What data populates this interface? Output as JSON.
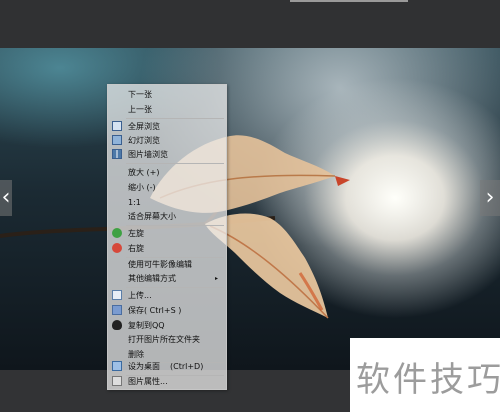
{
  "navigation": {
    "prev_arrow": "‹",
    "next_arrow": "›"
  },
  "context_menu": {
    "items": [
      {
        "label": "下一张"
      },
      {
        "label": "上一张"
      },
      {
        "label": "全屏浏览",
        "icon": "fullscreen-icon"
      },
      {
        "label": "幻灯浏览",
        "icon": "slideshow-icon"
      },
      {
        "label": "图片墙浏览",
        "icon": "picture-wall-icon"
      },
      {
        "label": "放大 (+)"
      },
      {
        "label": "缩小 (-)"
      },
      {
        "label": "1:1"
      },
      {
        "label": "适合屏幕大小"
      },
      {
        "label": "左旋",
        "icon": "rotate-left-icon"
      },
      {
        "label": "右旋",
        "icon": "rotate-right-icon"
      },
      {
        "label": "使用可牛影像编辑"
      },
      {
        "label": "其他编辑方式",
        "submenu_arrow": "▸"
      },
      {
        "label": "上传...",
        "icon": "upload-icon"
      },
      {
        "label": "保存( Ctrl+S )",
        "icon": "save-icon"
      },
      {
        "label": "复制到QQ",
        "icon": "qq-icon"
      },
      {
        "label": "打开图片所在文件夹"
      },
      {
        "label": "删除"
      },
      {
        "label": "设为桌面",
        "shortcut": "(Ctrl+D)",
        "icon": "desktop-icon"
      },
      {
        "label": "图片属性...",
        "icon": "properties-icon"
      }
    ]
  },
  "watermark": {
    "text": "软件技巧"
  }
}
